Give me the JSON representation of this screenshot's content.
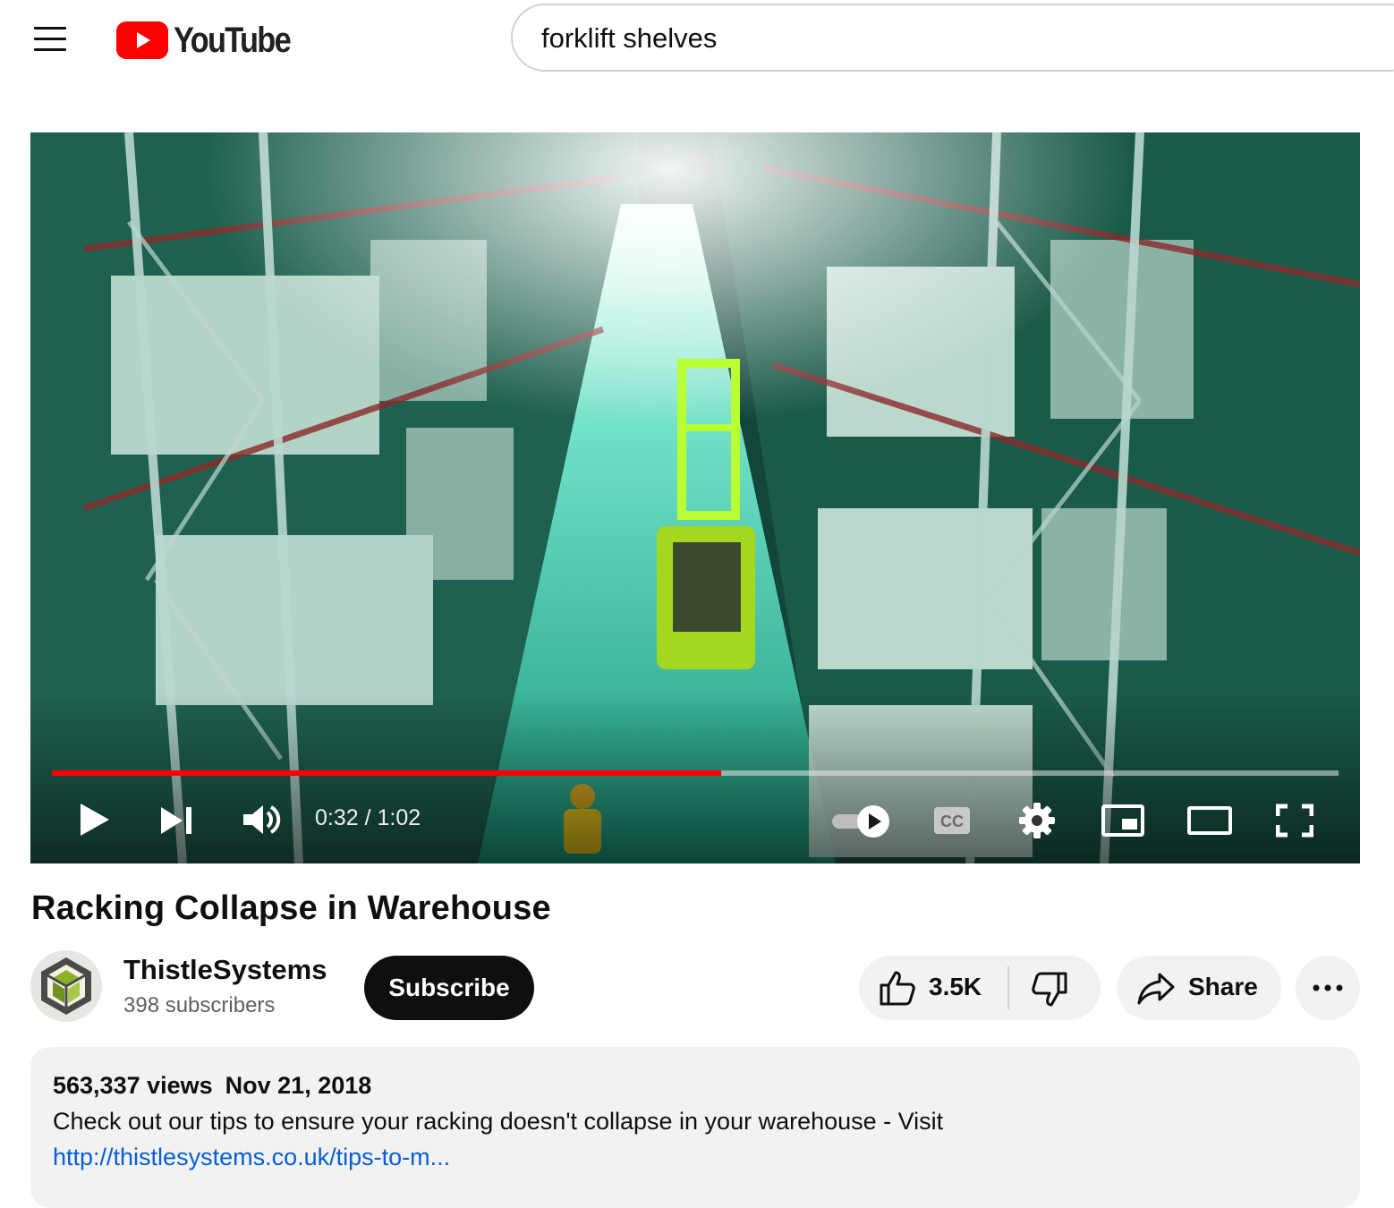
{
  "header": {
    "logo_text": "YouTube",
    "search": {
      "value": "forklift shelves"
    }
  },
  "player": {
    "progress_fraction": 0.52,
    "time_display": "0:32 / 1:02",
    "icons": [
      "play-icon",
      "next-icon",
      "volume-icon",
      "autoplay-toggle-icon",
      "cc-icon",
      "settings-icon",
      "miniplayer-icon",
      "theater-icon",
      "fullscreen-icon"
    ],
    "accent_color": "#ff0000"
  },
  "video": {
    "title": "Racking Collapse in Warehouse"
  },
  "channel": {
    "name": "ThistleSystems",
    "subscribers": "398 subscribers",
    "subscribe_label": "Subscribe"
  },
  "actions": {
    "like_count": "3.5K",
    "share_label": "Share",
    "more_icon": "more-dots-icon"
  },
  "description": {
    "views": "563,337 views",
    "date": "Nov 21, 2018",
    "text": "Check out our tips to ensure your racking doesn't collapse in your warehouse - Visit",
    "link": "http://thistlesystems.co.uk/tips-to-m..."
  }
}
